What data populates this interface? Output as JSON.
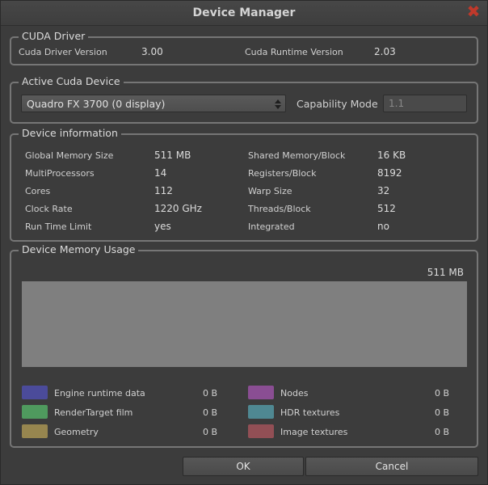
{
  "window": {
    "title": "Device Manager",
    "close_glyph": "✖"
  },
  "cuda_driver": {
    "title": "CUDA Driver",
    "driver_version_label": "Cuda Driver Version",
    "driver_version_value": "3.00",
    "runtime_version_label": "Cuda Runtime Version",
    "runtime_version_value": "2.03"
  },
  "active_device": {
    "title": "Active Cuda Device",
    "selected": "Quadro FX 3700 (0 display)",
    "capability_label": "Capability Mode",
    "capability_value": "1.1"
  },
  "device_info": {
    "title": "Device information",
    "left": [
      {
        "label": "Global Memory Size",
        "value": "511 MB"
      },
      {
        "label": "MultiProcessors",
        "value": "14"
      },
      {
        "label": "Cores",
        "value": "112"
      },
      {
        "label": "Clock Rate",
        "value": "1220 GHz"
      },
      {
        "label": "Run Time Limit",
        "value": "yes"
      }
    ],
    "right": [
      {
        "label": "Shared Memory/Block",
        "value": "16 KB"
      },
      {
        "label": "Registers/Block",
        "value": "8192"
      },
      {
        "label": "Warp Size",
        "value": "32"
      },
      {
        "label": "Threads/Block",
        "value": "512"
      },
      {
        "label": "Integrated",
        "value": "no"
      }
    ]
  },
  "memory_usage": {
    "title": "Device Memory Usage",
    "total": "511 MB",
    "bar_color": "#7f7f7f",
    "legend_left": [
      {
        "label": "Engine runtime data",
        "value": "0 B",
        "color": "#4b4b9a"
      },
      {
        "label": "RenderTarget film",
        "value": "0 B",
        "color": "#4f9a5e"
      },
      {
        "label": "Geometry",
        "value": "0 B",
        "color": "#97864f"
      }
    ],
    "legend_right": [
      {
        "label": "Nodes",
        "value": "0 B",
        "color": "#8a4e93"
      },
      {
        "label": "HDR textures",
        "value": "0 B",
        "color": "#4f8892"
      },
      {
        "label": "Image textures",
        "value": "0 B",
        "color": "#924f55"
      }
    ]
  },
  "buttons": {
    "ok": "OK",
    "cancel": "Cancel"
  }
}
